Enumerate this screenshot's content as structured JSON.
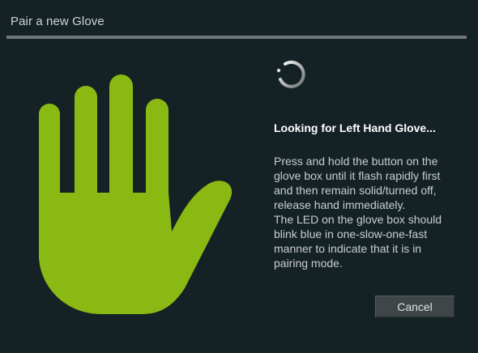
{
  "dialog": {
    "title": "Pair a new Glove",
    "status_heading": "Looking for Left Hand Glove...",
    "instructions": [
      "Press and hold the button on the",
      "glove box until it flash rapidly first",
      "and then remain solid/turned off,",
      "release hand immediately.",
      "The LED on the glove box should",
      "blink blue in one-slow-one-fast",
      "manner to indicate that it is in",
      "pairing mode."
    ],
    "cancel_label": "Cancel"
  },
  "icons": {
    "hand": "left-hand-icon",
    "spinner": "loading-spinner-icon"
  },
  "colors": {
    "background": "#152225",
    "hand": "#8ab914",
    "accent_rule": "#6e7577"
  }
}
